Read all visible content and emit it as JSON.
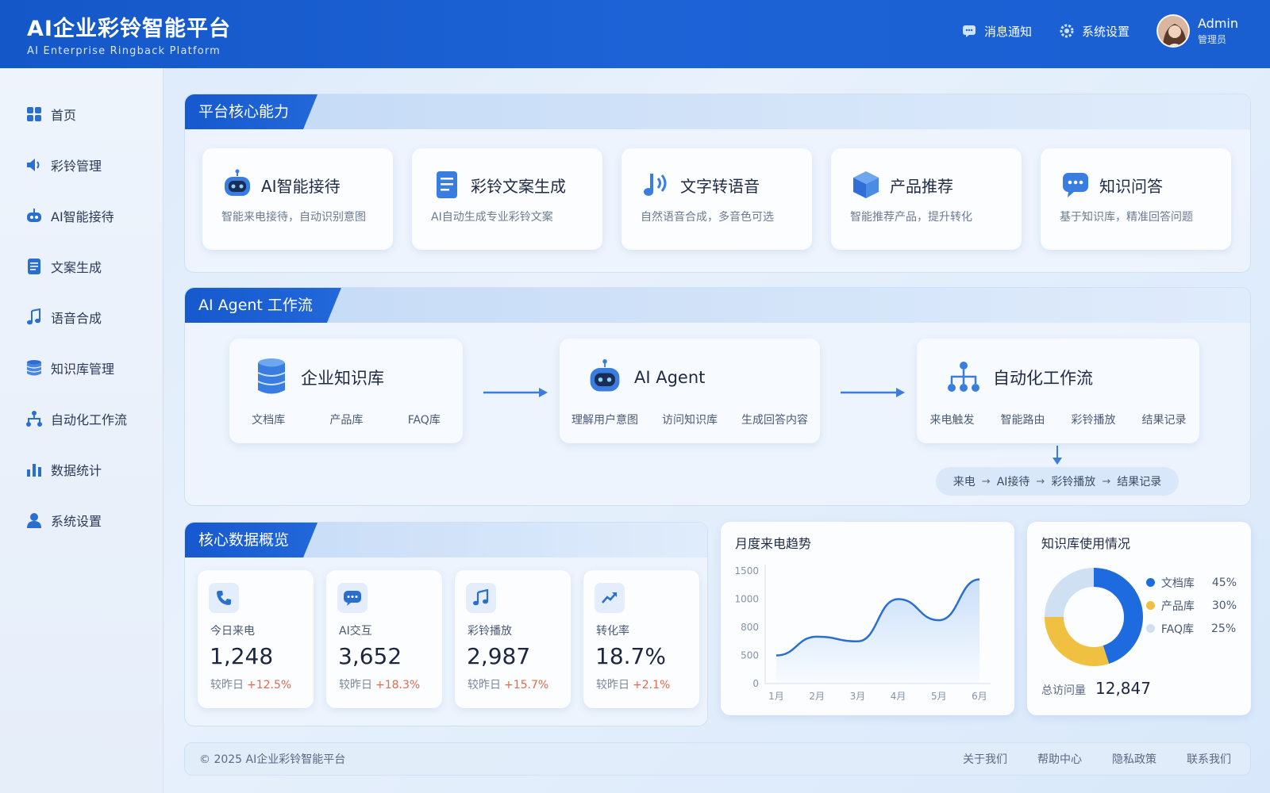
{
  "header": {
    "title": "AI企业彩铃智能平台",
    "subtitle": "AI Enterprise Ringback Platform",
    "notifications_label": "消息通知",
    "settings_label": "系统设置",
    "user_name": "Admin",
    "user_role": "管理员"
  },
  "sidebar": {
    "items": [
      {
        "label": "首页",
        "icon": "grid-icon"
      },
      {
        "label": "彩铃管理",
        "icon": "speaker-icon"
      },
      {
        "label": "AI智能接待",
        "icon": "robot-icon"
      },
      {
        "label": "文案生成",
        "icon": "document-icon"
      },
      {
        "label": "语音合成",
        "icon": "music-note-icon"
      },
      {
        "label": "知识库管理",
        "icon": "database-icon"
      },
      {
        "label": "自动化工作流",
        "icon": "workflow-icon"
      },
      {
        "label": "数据统计",
        "icon": "bar-chart-icon"
      },
      {
        "label": "系统设置",
        "icon": "user-icon"
      }
    ]
  },
  "capabilities": {
    "section_title": "平台核心能力",
    "cards": [
      {
        "title": "AI智能接待",
        "desc": "智能来电接待，自动识别意图",
        "icon": "robot-icon"
      },
      {
        "title": "彩铃文案生成",
        "desc": "AI自动生成专业彩铃文案",
        "icon": "document-icon"
      },
      {
        "title": "文字转语音",
        "desc": "自然语音合成，多音色可选",
        "icon": "voice-note-icon"
      },
      {
        "title": "产品推荐",
        "desc": "智能推荐产品，提升转化",
        "icon": "cube-icon"
      },
      {
        "title": "知识问答",
        "desc": "基于知识库，精准回答问题",
        "icon": "chat-bubble-icon"
      }
    ]
  },
  "workflow": {
    "section_title": "AI Agent 工作流",
    "nodes": [
      {
        "title": "企业知识库",
        "tags": [
          "文档库",
          "产品库",
          "FAQ库"
        ],
        "icon": "database-icon"
      },
      {
        "title": "AI Agent",
        "tags": [
          "理解用户意图",
          "访问知识库",
          "生成回答内容"
        ],
        "icon": "robot-icon"
      },
      {
        "title": "自动化工作流",
        "tags": [
          "来电触发",
          "智能路由",
          "彩铃播放",
          "结果记录"
        ],
        "icon": "workflow-icon"
      }
    ],
    "flow": [
      "来电",
      "AI接待",
      "彩铃播放",
      "结果记录"
    ]
  },
  "overview": {
    "section_title": "核心数据概览",
    "compare_label": "较昨日",
    "stats": [
      {
        "label": "今日来电",
        "value": "1,248",
        "delta": "+12.5%",
        "icon": "phone-icon"
      },
      {
        "label": "AI交互",
        "value": "3,652",
        "delta": "+18.3%",
        "icon": "chat-bubble-icon"
      },
      {
        "label": "彩铃播放",
        "value": "2,987",
        "delta": "+15.7%",
        "icon": "music-note-icon"
      },
      {
        "label": "转化率",
        "value": "18.7%",
        "delta": "+2.1%",
        "icon": "trend-up-icon"
      }
    ]
  },
  "chart_data": [
    {
      "type": "line",
      "title": "月度来电趋势",
      "categories": [
        "1月",
        "2月",
        "3月",
        "4月",
        "5月",
        "6月"
      ],
      "y_ticks": [
        "1500",
        "1000",
        "800",
        "500",
        "0"
      ],
      "values": [
        500,
        700,
        650,
        1000,
        850,
        1350
      ],
      "color": "#2a6fd0"
    },
    {
      "type": "pie",
      "title": "知识库使用情况",
      "series": [
        {
          "name": "文档库",
          "value": 45,
          "label": "45%",
          "color": "#1e6be0"
        },
        {
          "name": "产品库",
          "value": 30,
          "label": "30%",
          "color": "#f0c040"
        },
        {
          "name": "FAQ库",
          "value": 25,
          "label": "25%",
          "color": "#cfe0f2"
        }
      ],
      "total_label": "总访问量",
      "total_value": "12,847"
    }
  ],
  "footer": {
    "copyright": "© 2025 AI企业彩铃智能平台",
    "links": [
      "关于我们",
      "帮助中心",
      "隐私政策",
      "联系我们"
    ]
  },
  "colors": {
    "primary": "#1659ce",
    "accent": "#2a6fd0",
    "positive_delta": "#e06a4e"
  }
}
